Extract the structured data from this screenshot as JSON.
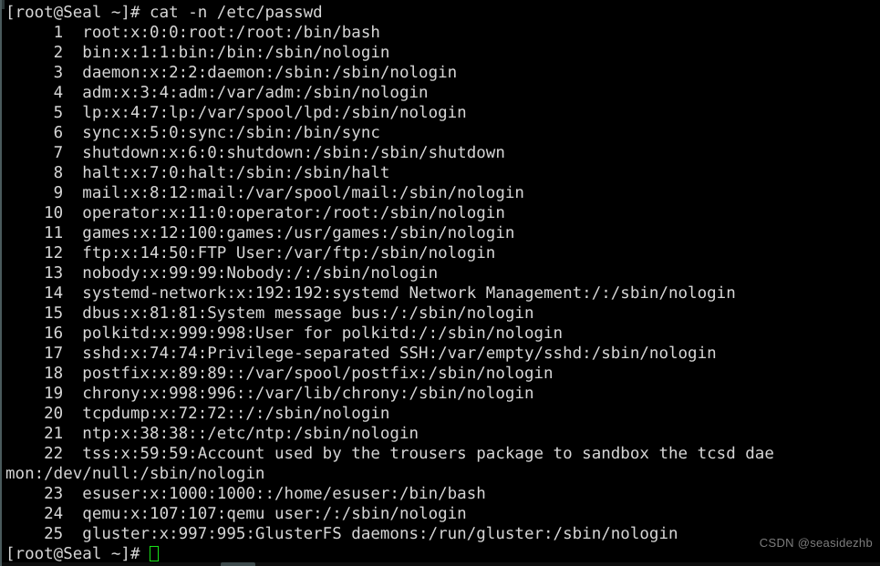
{
  "terminal": {
    "prompt": "[root@Seal ~]# ",
    "command": "cat -n /etc/passwd",
    "final_prompt": "[root@Seal ~]# ",
    "cursor": "block-cursor",
    "colors": {
      "background": "#000000",
      "foreground": "#d6d6d6",
      "cursor": "#19e219",
      "watermark": "#7d7d7d",
      "border": "#4a5a5c"
    },
    "lines": [
      "     1  root:x:0:0:root:/root:/bin/bash",
      "     2  bin:x:1:1:bin:/bin:/sbin/nologin",
      "     3  daemon:x:2:2:daemon:/sbin:/sbin/nologin",
      "     4  adm:x:3:4:adm:/var/adm:/sbin/nologin",
      "     5  lp:x:4:7:lp:/var/spool/lpd:/sbin/nologin",
      "     6  sync:x:5:0:sync:/sbin:/bin/sync",
      "     7  shutdown:x:6:0:shutdown:/sbin:/sbin/shutdown",
      "     8  halt:x:7:0:halt:/sbin:/sbin/halt",
      "     9  mail:x:8:12:mail:/var/spool/mail:/sbin/nologin",
      "    10  operator:x:11:0:operator:/root:/sbin/nologin",
      "    11  games:x:12:100:games:/usr/games:/sbin/nologin",
      "    12  ftp:x:14:50:FTP User:/var/ftp:/sbin/nologin",
      "    13  nobody:x:99:99:Nobody:/:/sbin/nologin",
      "    14  systemd-network:x:192:192:systemd Network Management:/:/sbin/nologin",
      "    15  dbus:x:81:81:System message bus:/:/sbin/nologin",
      "    16  polkitd:x:999:998:User for polkitd:/:/sbin/nologin",
      "    17  sshd:x:74:74:Privilege-separated SSH:/var/empty/sshd:/sbin/nologin",
      "    18  postfix:x:89:89::/var/spool/postfix:/sbin/nologin",
      "    19  chrony:x:998:996::/var/lib/chrony:/sbin/nologin",
      "    20  tcpdump:x:72:72::/:/sbin/nologin",
      "    21  ntp:x:38:38::/etc/ntp:/sbin/nologin",
      "    22  tss:x:59:59:Account used by the trousers package to sandbox the tcsd daemon:/dev/null:/sbin/nologin",
      "mon:/dev/null:/sbin/nologin",
      "    23  esuser:x:1000:1000::/home/esuser:/bin/bash",
      "    24  qemu:x:107:107:qemu user:/:/sbin/nologin",
      "    25  gluster:x:997:995:GlusterFS daemons:/run/gluster:/sbin/nologin"
    ],
    "wrapped_line_22_visible": "    22  tss:x:59:59:Account used by the trousers package to sandbox the tcsd dae",
    "wrapped_line_22_continuation": "mon:/dev/null:/sbin/nologin"
  },
  "watermark": {
    "text": "CSDN @seasidezhb"
  }
}
